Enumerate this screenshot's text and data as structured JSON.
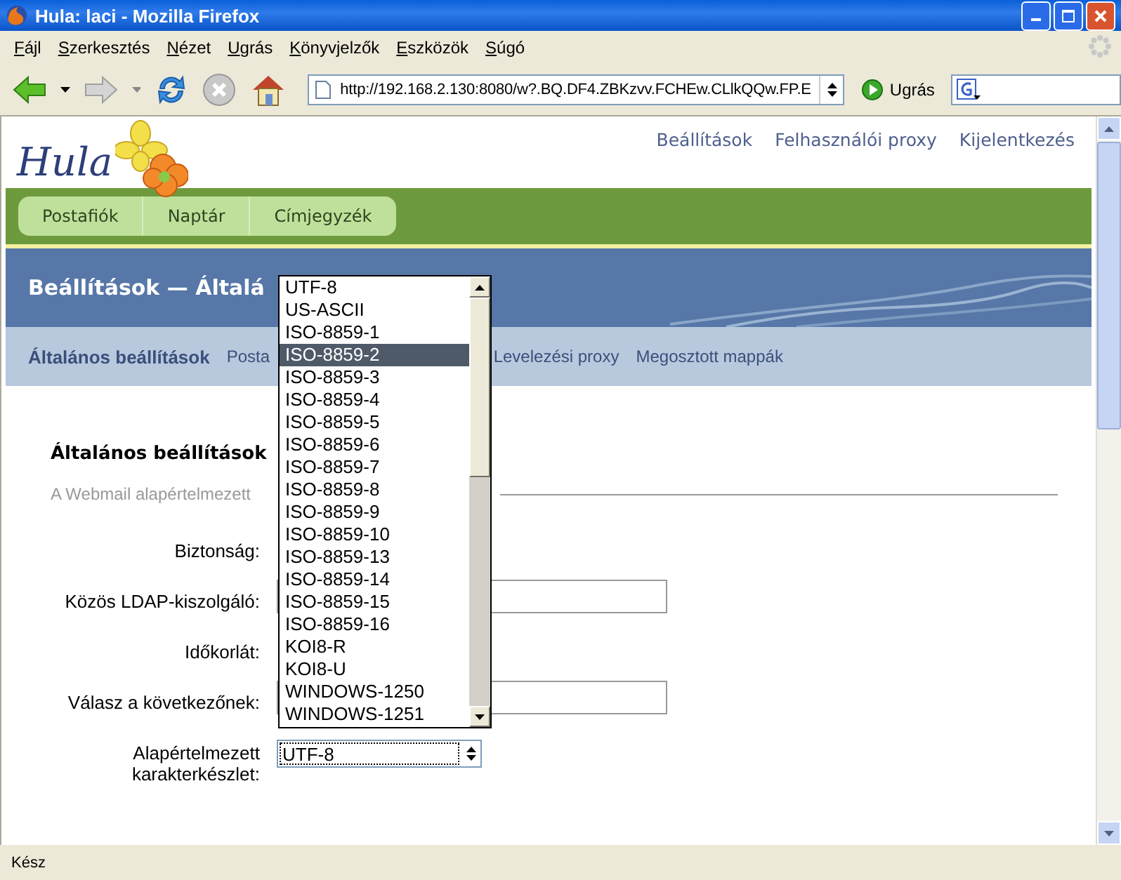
{
  "window": {
    "title": "Hula: laci - Mozilla Firefox"
  },
  "menu": [
    "Fájl",
    "Szerkesztés",
    "Nézet",
    "Ugrás",
    "Könyvjelzők",
    "Eszközök",
    "Súgó"
  ],
  "toolbar": {
    "url": "http://192.168.2.130:8080/w?.BQ.DF4.ZBKzvv.FCHEw.CLlkQQw.FP.E",
    "go_label": "Ugrás"
  },
  "header": {
    "logo_text": "Hula",
    "links": [
      "Beállítások",
      "Felhasználói proxy",
      "Kijelentkezés"
    ]
  },
  "nav_tabs": [
    "Postafiók",
    "Naptár",
    "Címjegyzék"
  ],
  "page_title": "Beállítások — Általá",
  "subnav": [
    {
      "label": "Általános beállítások",
      "selected": true
    },
    {
      "label": "Posta",
      "selected": false
    },
    {
      "label": "Levelezési proxy",
      "selected": false
    },
    {
      "label": "Megosztott mappák",
      "selected": false
    }
  ],
  "section": {
    "title": "Általános beállítások",
    "subtitle": "A Webmail alapértelmezett"
  },
  "form": [
    {
      "label": "Biztonság:",
      "kind": "covered"
    },
    {
      "label": "Közös LDAP-kiszolgáló:",
      "kind": "text"
    },
    {
      "label": "Időkorlát:",
      "kind": "covered"
    },
    {
      "label": "Válasz a következőnek:",
      "kind": "text"
    },
    {
      "label": "Alapértelmezett karakterkészlet:",
      "kind": "select",
      "value": "UTF-8"
    }
  ],
  "dropdown": {
    "options": [
      {
        "label": "UTF-8",
        "selected": false
      },
      {
        "label": "US-ASCII",
        "selected": false
      },
      {
        "label": "ISO-8859-1",
        "selected": false
      },
      {
        "label": "ISO-8859-2",
        "selected": true
      },
      {
        "label": "ISO-8859-3",
        "selected": false
      },
      {
        "label": "ISO-8859-4",
        "selected": false
      },
      {
        "label": "ISO-8859-5",
        "selected": false
      },
      {
        "label": "ISO-8859-6",
        "selected": false
      },
      {
        "label": "ISO-8859-7",
        "selected": false
      },
      {
        "label": "ISO-8859-8",
        "selected": false
      },
      {
        "label": "ISO-8859-9",
        "selected": false
      },
      {
        "label": "ISO-8859-10",
        "selected": false
      },
      {
        "label": "ISO-8859-13",
        "selected": false
      },
      {
        "label": "ISO-8859-14",
        "selected": false
      },
      {
        "label": "ISO-8859-15",
        "selected": false
      },
      {
        "label": "ISO-8859-16",
        "selected": false
      },
      {
        "label": "KOI8-R",
        "selected": false
      },
      {
        "label": "KOI8-U",
        "selected": false
      },
      {
        "label": "WINDOWS-1250",
        "selected": false
      },
      {
        "label": "WINDOWS-1251",
        "selected": false
      }
    ]
  },
  "status_bar": "Kész"
}
